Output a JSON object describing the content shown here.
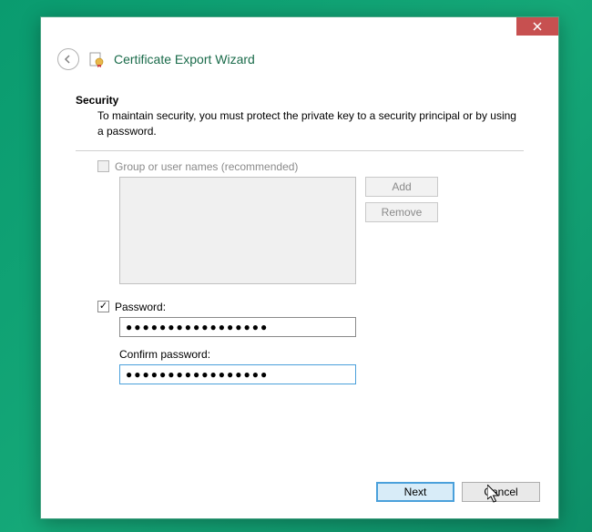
{
  "window": {
    "title": "Certificate Export Wizard"
  },
  "security": {
    "heading": "Security",
    "description": "To maintain security, you must protect the private key to a security principal or by using a password."
  },
  "group": {
    "checkbox_label": "Group or user names (recommended)",
    "checked": false,
    "add_label": "Add",
    "remove_label": "Remove"
  },
  "password": {
    "checkbox_label": "Password:",
    "checked": true,
    "value": "●●●●●●●●●●●●●●●●●",
    "confirm_label": "Confirm password:",
    "confirm_value": "●●●●●●●●●●●●●●●●●"
  },
  "footer": {
    "next_label": "Next",
    "cancel_label": "Cancel"
  }
}
